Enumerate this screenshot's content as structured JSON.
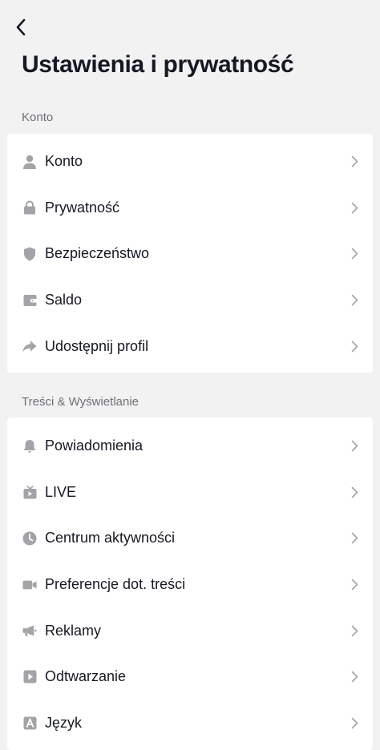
{
  "header": {
    "back_icon": "chevron-left-icon",
    "title": "Ustawienia i prywatność"
  },
  "sections": [
    {
      "label": "Konto",
      "items": [
        {
          "label": "Konto",
          "icon": "person-icon"
        },
        {
          "label": "Prywatność",
          "icon": "lock-icon"
        },
        {
          "label": "Bezpieczeństwo",
          "icon": "shield-icon"
        },
        {
          "label": "Saldo",
          "icon": "wallet-icon"
        },
        {
          "label": "Udostępnij profil",
          "icon": "share-arrow-icon"
        }
      ]
    },
    {
      "label": "Treści & Wyświetlanie",
      "items": [
        {
          "label": "Powiadomienia",
          "icon": "bell-icon"
        },
        {
          "label": "LIVE",
          "icon": "live-tv-icon"
        },
        {
          "label": "Centrum aktywności",
          "icon": "clock-icon"
        },
        {
          "label": "Preferencje dot. treści",
          "icon": "video-camera-icon"
        },
        {
          "label": "Reklamy",
          "icon": "megaphone-icon"
        },
        {
          "label": "Odtwarzanie",
          "icon": "play-icon"
        },
        {
          "label": "Język",
          "icon": "language-a-icon"
        }
      ]
    }
  ],
  "colors": {
    "background": "#f2f2f3",
    "card": "#ffffff",
    "text": "#161823",
    "section_label": "#6f7075",
    "icon": "#a3a4a8",
    "chevron": "#a3a4a8"
  }
}
